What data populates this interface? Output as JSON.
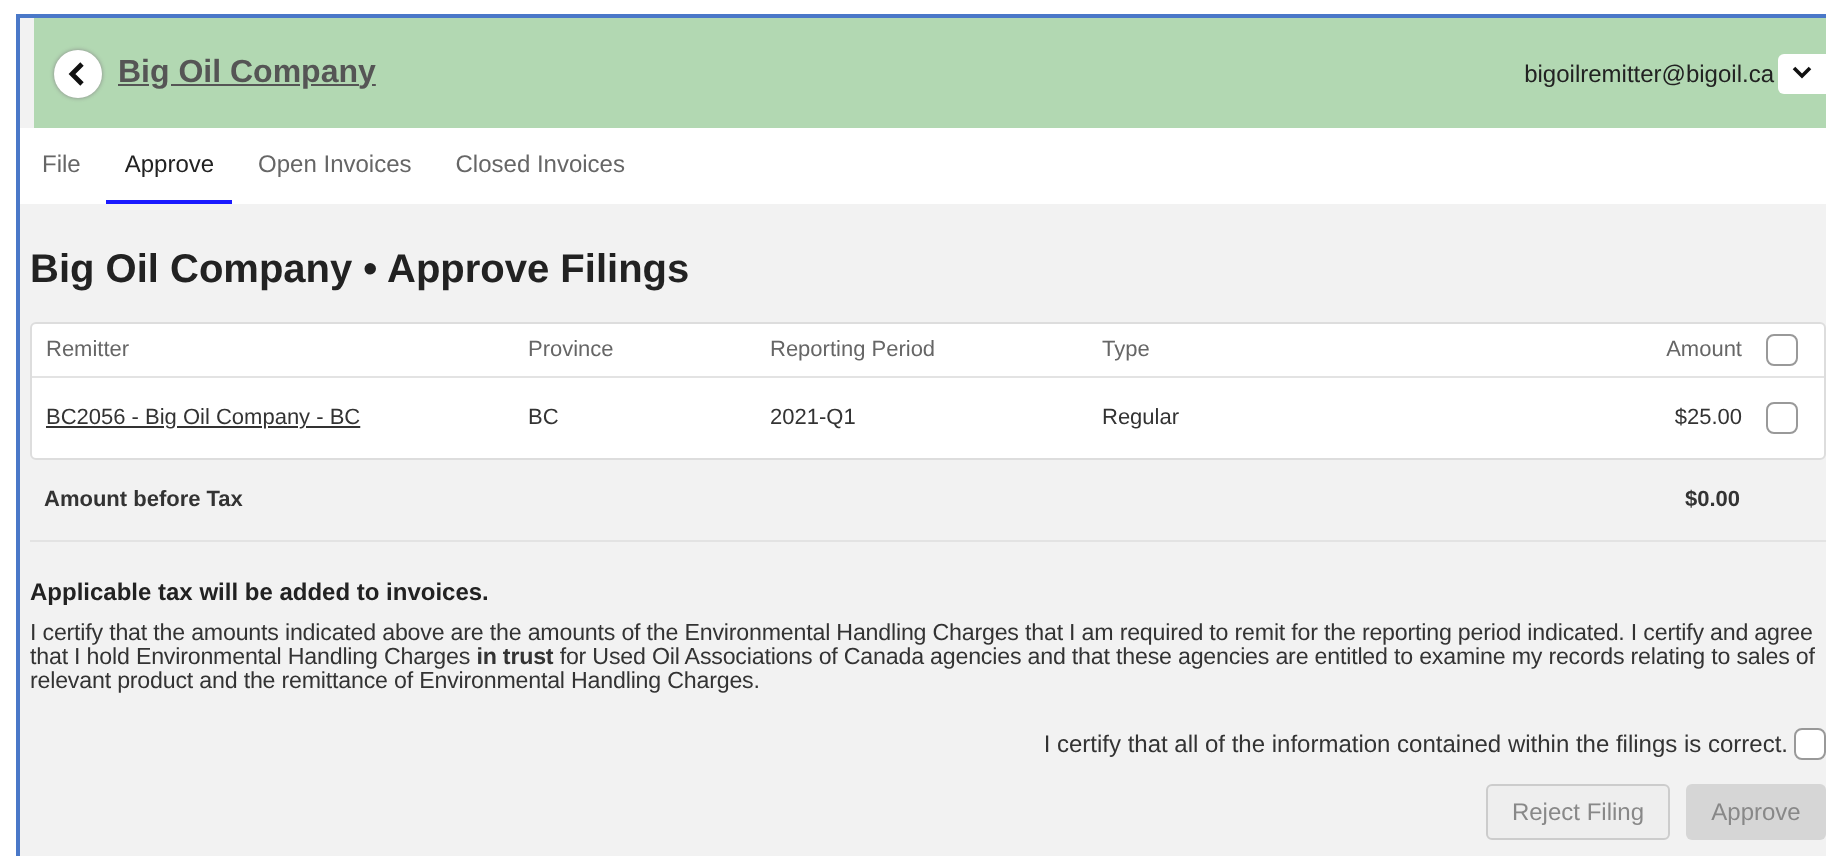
{
  "header": {
    "title": "Big Oil Company",
    "user": "bigoilremitter@bigoil.ca"
  },
  "tabs": [
    {
      "label": "File",
      "selected": false
    },
    {
      "label": "Approve",
      "selected": true
    },
    {
      "label": "Open Invoices",
      "selected": false
    },
    {
      "label": "Closed Invoices",
      "selected": false
    }
  ],
  "page_title": "Big Oil Company • Approve Filings",
  "table": {
    "columns": [
      "Remitter",
      "Province",
      "Reporting Period",
      "Type",
      "Amount"
    ],
    "select_all_checked": false,
    "rows": [
      {
        "remitter": "BC2056 - Big Oil Company - BC",
        "province": "BC",
        "period": "2021-Q1",
        "type": "Regular",
        "amount": "$25.00",
        "checked": false
      }
    ],
    "total_label": "Amount before Tax",
    "total": "$0.00"
  },
  "tax_note": "Applicable tax will be added to invoices.",
  "certification_text": "I certify that the amounts indicated above are the amounts of the Environmental Handling Charges that I am required to remit for the reporting period indicated. I certify and agree that I hold Environmental Handling Charges **in trust** for Used Oil Associations of Canada agencies and that these agencies are entitled to examine my records relating to sales of relevant product and the remittance of Environmental Handling Charges.",
  "confirm": {
    "label": "I certify that all of the information contained within the filings is correct.",
    "checked": false
  },
  "buttons": [
    {
      "label": "Reject Filing",
      "kind": "secondary",
      "disabled": true
    },
    {
      "label": "Approve",
      "kind": "primary",
      "disabled": true
    }
  ]
}
